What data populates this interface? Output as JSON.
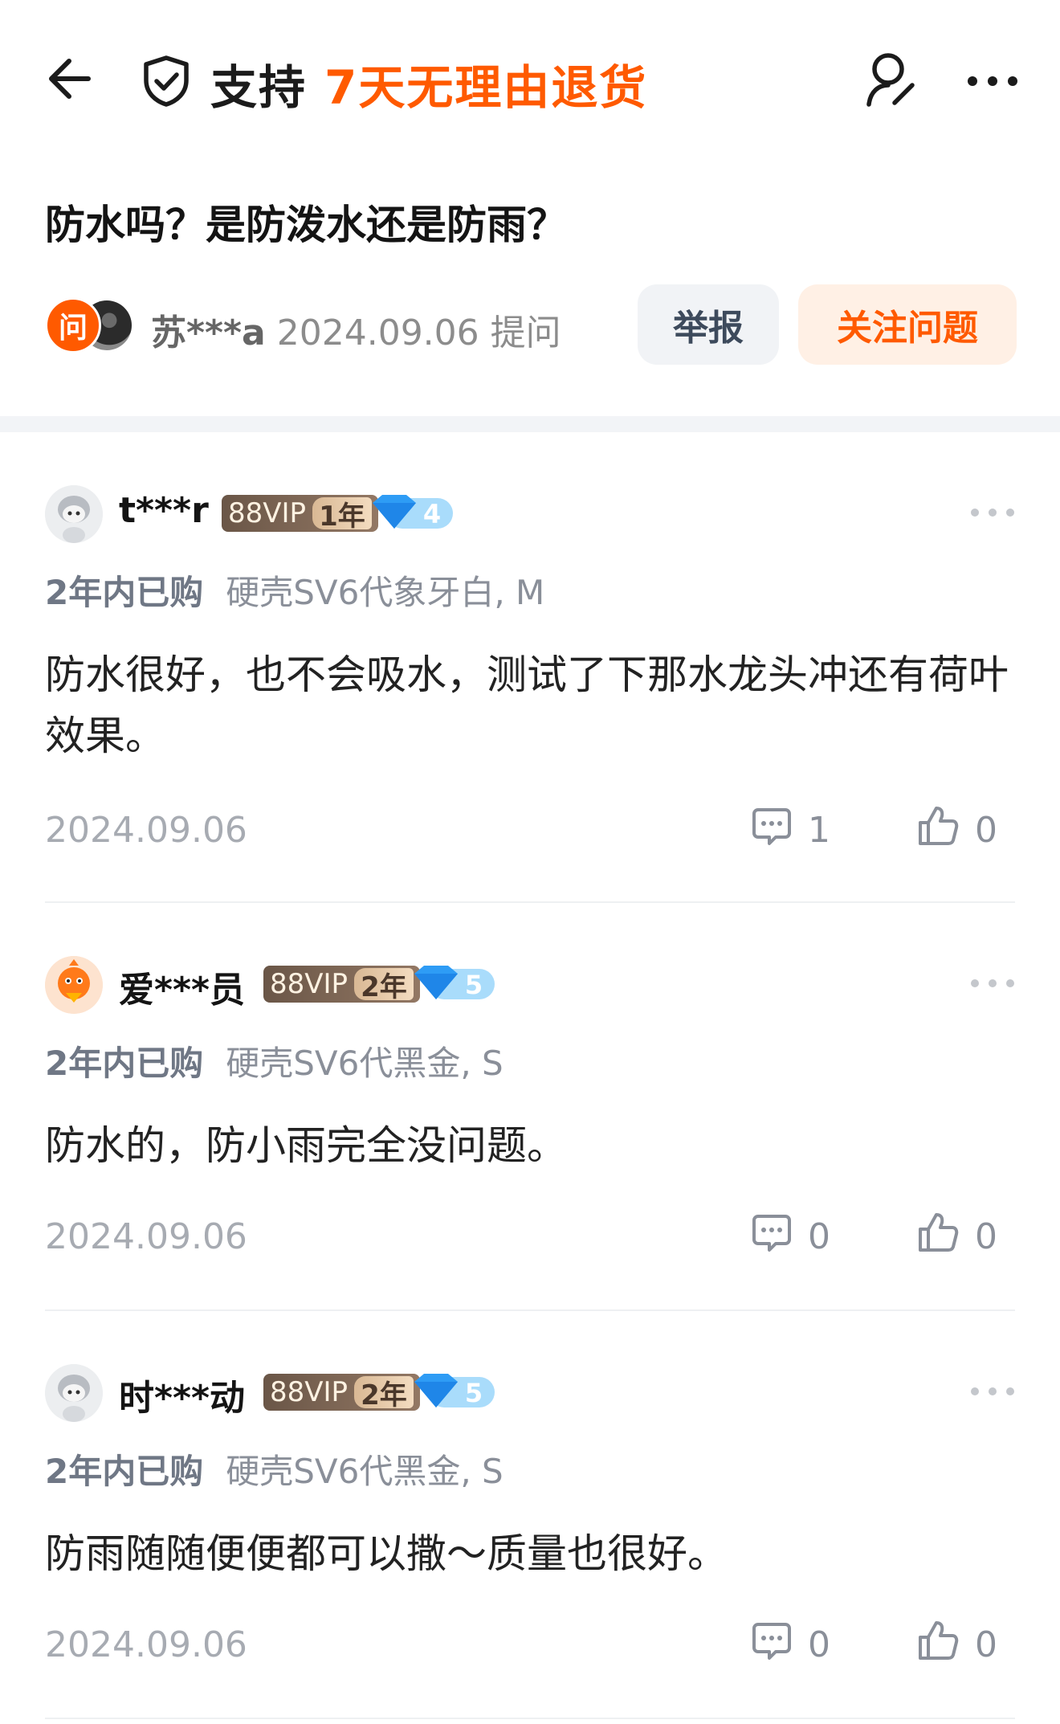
{
  "header": {
    "support_label": "支持",
    "return_policy": "7天无理由退货"
  },
  "question": {
    "title": "防水吗？是防泼水还是防雨？",
    "avatar_char": "问",
    "asker_name": "苏***a",
    "asked_date": "2024.09.06 提问",
    "report_label": "举报",
    "follow_label": "关注问题"
  },
  "answers": [
    {
      "name": "t***r",
      "vip_label": "88VIP",
      "vip_years": "1年",
      "gem_level": "4",
      "purchase_time": "2年内已购",
      "sku": "硬壳SV6代象牙白, M",
      "text": "防水很好，也不会吸水，测试了下那水龙头冲还有荷叶效果。",
      "date": "2024.09.06",
      "comments": "1",
      "likes": "0"
    },
    {
      "name": "爱***员",
      "vip_label": "88VIP",
      "vip_years": "2年",
      "gem_level": "5",
      "purchase_time": "2年内已购",
      "sku": "硬壳SV6代黑金, S",
      "text": "防水的，防小雨完全没问题。",
      "date": "2024.09.06",
      "comments": "0",
      "likes": "0"
    },
    {
      "name": "时***动",
      "vip_label": "88VIP",
      "vip_years": "2年",
      "gem_level": "5",
      "purchase_time": "2年内已购",
      "sku": "硬壳SV6代黑金, S",
      "text": "防雨随随便便都可以撒～质量也很好。",
      "date": "2024.09.06",
      "comments": "0",
      "likes": "0"
    }
  ],
  "colors": {
    "accent": "#ff5a00",
    "follow_bg": "#fff0e5",
    "report_bg": "#f1f3f6",
    "muted": "#8a8f99"
  }
}
